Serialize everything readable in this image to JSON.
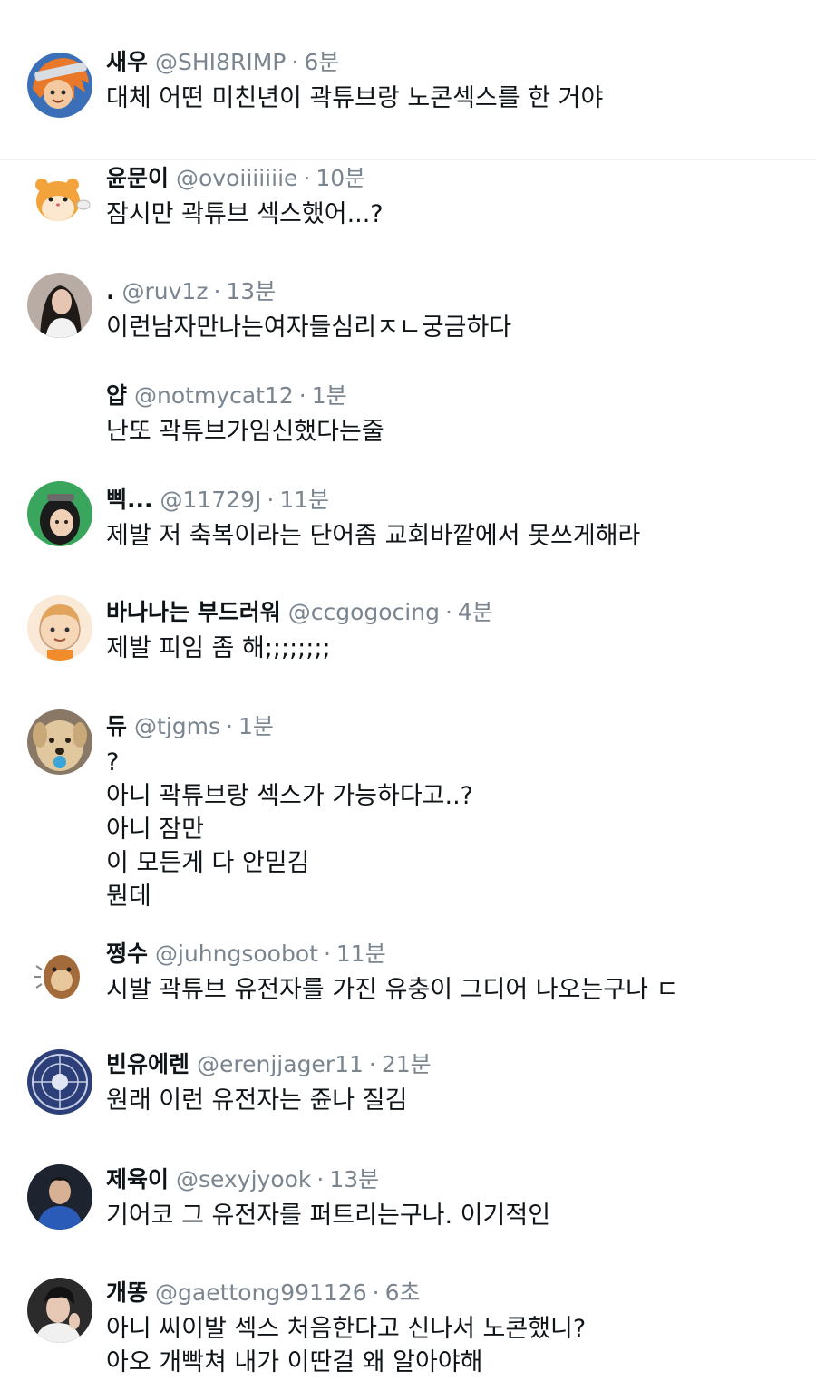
{
  "tweets": [
    {
      "name": "새우",
      "handle": "@SHI8RIMP",
      "time": "6분",
      "lines": [
        "대체 어떤 미친년이 곽튜브랑 노콘섹스를 한 거야"
      ]
    },
    {
      "name": "윤문이",
      "handle": "@ovoiiiiiiie",
      "time": "10분",
      "lines": [
        "잠시만 곽튜브 섹스했어...?"
      ]
    },
    {
      "name": ".",
      "handle": "@ruv1z",
      "time": "13분",
      "lines": [
        "이런남자만나는여자들심리ㅈㄴ궁금하다"
      ]
    },
    {
      "name": "얍",
      "handle": "@notmycat12",
      "time": "1분",
      "lines": [
        "난또 곽튜브가임신했다는줄"
      ]
    },
    {
      "name": "삑...",
      "handle": "@11729J",
      "time": "11분",
      "lines": [
        "제발 저 축복이라는 단어좀 교회바깥에서 못쓰게해라"
      ]
    },
    {
      "name": "바나나는 부드러워",
      "handle": "@ccgogocing",
      "time": "4분",
      "lines": [
        "제발 피임 좀 해;;;;;;;;"
      ]
    },
    {
      "name": "듀",
      "handle": "@tjgms",
      "time": "1분",
      "lines": [
        "?",
        "아니 곽튜브랑 섹스가 가능하다고..?",
        "아니 잠만",
        "이 모든게 다 안믿김",
        "뭔데"
      ]
    },
    {
      "name": "쩡수",
      "handle": "@juhngsoobot",
      "time": "11분",
      "lines": [
        "시발 곽튜브 유전자를 가진 유충이 그디어 나오는구나 ㄷ"
      ]
    },
    {
      "name": "빈유에렌",
      "handle": "@erenjjager11",
      "time": "21분",
      "lines": [
        "원래 이런 유전자는 쥰나 질김"
      ]
    },
    {
      "name": "제육이",
      "handle": "@sexyjyook",
      "time": "13분",
      "lines": [
        "기어코 그 유전자를 퍼트리는구나. 이기적인"
      ]
    },
    {
      "name": "개똥",
      "handle": "@gaettong991126",
      "time": "6초",
      "lines": [
        "아니 씨이발 섹스 처음한다고 신나서 노콘했니?",
        "아오 개빡쳐 내가 이딴걸 왜 알아야해"
      ]
    }
  ],
  "separator": "·",
  "avatars": [
    "anime-orange-hair-avatar",
    "hamster-cartoon-avatar",
    "woman-photo-avatar",
    "",
    "cartoon-girl-avatar",
    "cartoon-character-avatar",
    "dog-photo-avatar",
    "cartoon-otter-avatar",
    "emblem-avatar",
    "soccer-player-photo-avatar",
    "person-photo-avatar"
  ]
}
